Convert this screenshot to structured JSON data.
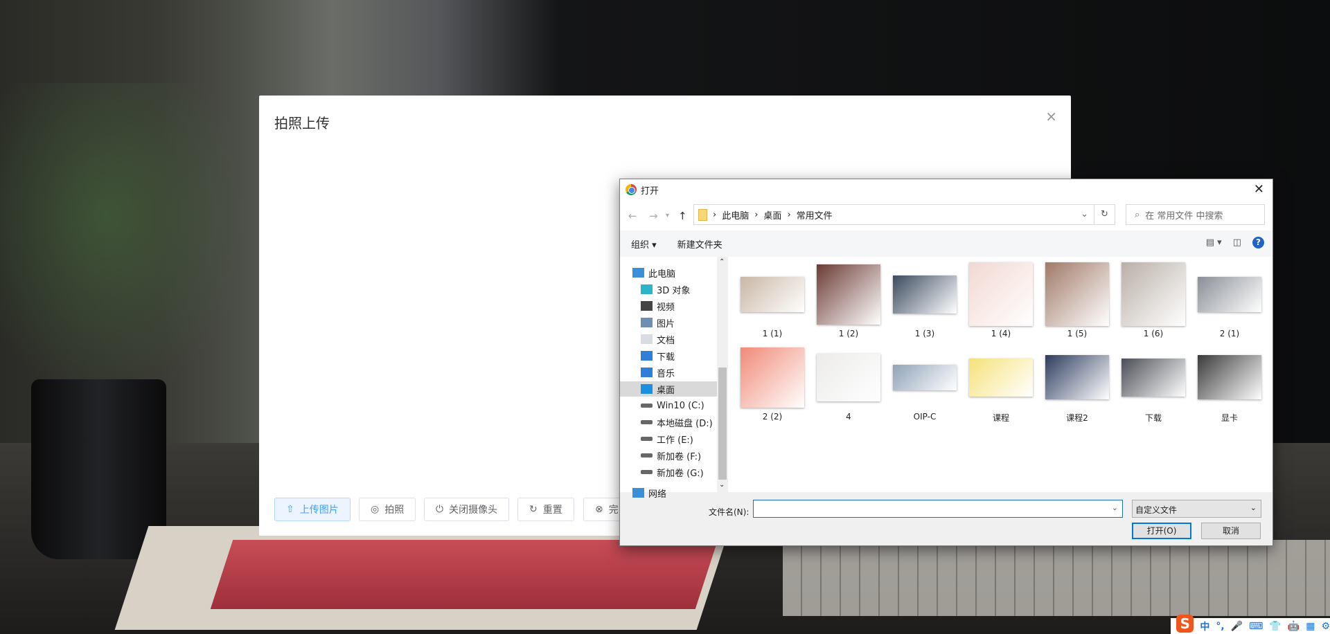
{
  "modal": {
    "title": "拍照上传",
    "close": "×",
    "buttons": [
      {
        "icon": "⇧",
        "label": "上传图片"
      },
      {
        "icon": "◎",
        "label": "拍照"
      },
      {
        "icon": "⏻",
        "label": "关闭摄像头"
      },
      {
        "icon": "↻",
        "label": "重置"
      },
      {
        "icon": "⊗",
        "label": "完"
      }
    ]
  },
  "dialog": {
    "title": "打开",
    "close": "✕",
    "breadcrumb": [
      "此电脑",
      "桌面",
      "常用文件"
    ],
    "search_placeholder": "在 常用文件 中搜索",
    "toolbar": {
      "organize": "组织 ▾",
      "new_folder": "新建文件夹"
    },
    "nav_items": [
      {
        "label": "此电脑",
        "icon": "computer"
      },
      {
        "label": "3D 对象",
        "icon": "cube"
      },
      {
        "label": "视频",
        "icon": "film"
      },
      {
        "label": "图片",
        "icon": "picture"
      },
      {
        "label": "文档",
        "icon": "document"
      },
      {
        "label": "下载",
        "icon": "download-arrow"
      },
      {
        "label": "音乐",
        "icon": "music-note"
      },
      {
        "label": "桌面",
        "icon": "desktop",
        "selected": true
      },
      {
        "label": "Win10 (C:)",
        "icon": "drive"
      },
      {
        "label": "本地磁盘 (D:)",
        "icon": "drive"
      },
      {
        "label": "工作 (E:)",
        "icon": "drive"
      },
      {
        "label": "新加卷 (F:)",
        "icon": "drive"
      },
      {
        "label": "新加卷 (G:)",
        "icon": "drive"
      },
      {
        "label": "网络",
        "icon": "network"
      }
    ],
    "files": [
      {
        "name": "1 (1)",
        "color": "#c9b7a4"
      },
      {
        "name": "1 (2)",
        "color": "#6b3b35"
      },
      {
        "name": "1 (3)",
        "color": "#3a4a5e"
      },
      {
        "name": "1 (4)",
        "color": "#f2d8d2"
      },
      {
        "name": "1 (5)",
        "color": "#a07a68"
      },
      {
        "name": "1 (6)",
        "color": "#b9b0a8"
      },
      {
        "name": "2 (1)",
        "color": "#8a8f96"
      },
      {
        "name": "2 (2)",
        "color": "#f08a78"
      },
      {
        "name": "4",
        "color": "#ecebea"
      },
      {
        "name": "OIP-C",
        "color": "#8fa3b8"
      },
      {
        "name": "课程",
        "color": "#f5e27a"
      },
      {
        "name": "课程2",
        "color": "#2d3c5e"
      },
      {
        "name": "下载",
        "color": "#4a4d55"
      },
      {
        "name": "显卡",
        "color": "#3a3a3a"
      }
    ],
    "filename_label": "文件名(N):",
    "filename_value": "",
    "filter": "自定义文件",
    "open": "打开(O)",
    "cancel": "取消"
  },
  "tray": {
    "ime": "S",
    "items": [
      "中",
      "°,",
      "🎤",
      "⌨",
      "👕",
      "🤖",
      "▦",
      "⚙"
    ]
  }
}
